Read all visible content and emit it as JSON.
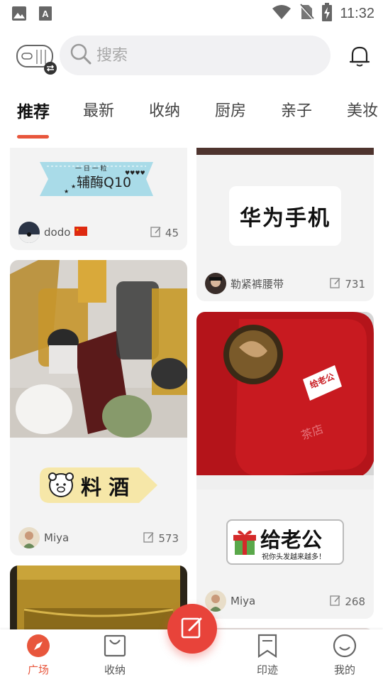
{
  "status_bar": {
    "time": "11:32",
    "icons": [
      "image-icon",
      "font-icon",
      "wifi-icon",
      "no-sim-icon",
      "battery-charging-icon"
    ]
  },
  "search": {
    "placeholder": "搜索"
  },
  "tabs": [
    {
      "label": "推荐",
      "active": true
    },
    {
      "label": "最新",
      "active": false
    },
    {
      "label": "收纳",
      "active": false
    },
    {
      "label": "厨房",
      "active": false
    },
    {
      "label": "亲子",
      "active": false
    },
    {
      "label": "美妆",
      "active": false
    }
  ],
  "feed": {
    "card1": {
      "label_text": "辅酶Q10",
      "label_small": "一 日 一 粒",
      "author": "dodo",
      "count": "45"
    },
    "card2": {
      "label_text": "华为手机",
      "author": "勒紧裤腰带",
      "count": "731"
    },
    "card3": {
      "label_text": "料 酒",
      "author": "Miya",
      "count": "573"
    },
    "card4": {
      "label_text": "给老公",
      "label_small": "祝你头发越来越多！",
      "author": "Miya",
      "count": "268",
      "stamp_text": "给老公"
    }
  },
  "bottom_nav": [
    {
      "label": "广场",
      "icon": "compass-icon",
      "active": true
    },
    {
      "label": "收纳",
      "icon": "bag-icon",
      "active": false
    },
    {
      "label": "印迹",
      "icon": "bookmark-icon",
      "active": false
    },
    {
      "label": "我的",
      "icon": "smile-icon",
      "active": false
    }
  ],
  "colors": {
    "accent": "#e8563c",
    "fab": "#e8433a",
    "card_bg": "#f3f3f3"
  }
}
